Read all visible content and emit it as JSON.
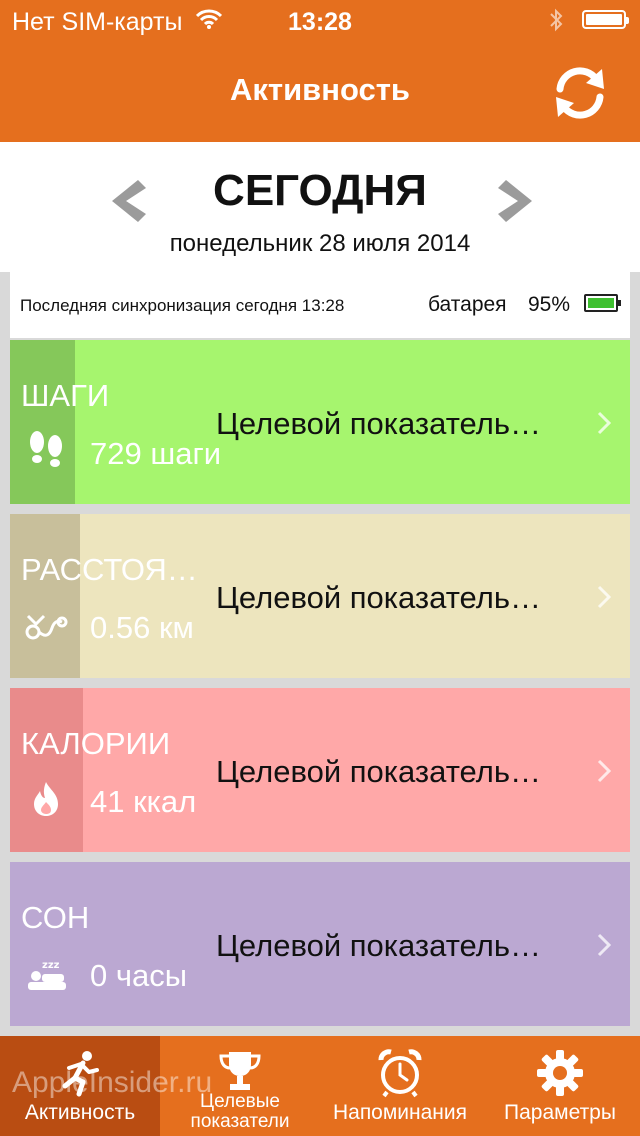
{
  "status_bar": {
    "carrier": "Нет SIM-карты",
    "time": "13:28",
    "wifi_icon": "wifi-icon",
    "bluetooth_icon": "bluetooth-icon",
    "battery_icon": "battery-icon"
  },
  "navbar": {
    "title": "Активность",
    "sync_icon": "sync-icon"
  },
  "date_header": {
    "day": "СЕГОДНЯ",
    "date": "понедельник 28 июля 2014"
  },
  "sync_info": {
    "last_sync": "Последняя синхронизация сегодня 13:28",
    "battery_label": "батарея",
    "battery_percent": "95%"
  },
  "cards": [
    {
      "label": "ШАГИ",
      "value": "729 шаги",
      "goal": "Целевой показатель…",
      "icon": "footsteps-icon",
      "color": "#a6f56e",
      "strip_color": "#85c85a"
    },
    {
      "label": "РАССТОЯ…",
      "value": "0.56 км",
      "goal": "Целевой показатель…",
      "icon": "route-icon",
      "color": "#ede5be",
      "strip_color": "#c8bf9b"
    },
    {
      "label": "КАЛОРИИ",
      "value": "41 ккал",
      "goal": "Целевой показатель…",
      "icon": "flame-icon",
      "color": "#ffa8a8",
      "strip_color": "#e98b8b"
    },
    {
      "label": "СОН",
      "value": "0 часы",
      "goal": "Целевой показатель…",
      "icon": "sleep-icon",
      "color": "#bba8d2",
      "strip_color": "#bba8d2"
    }
  ],
  "tabs": [
    {
      "label": "Активность",
      "icon": "running-icon",
      "active": true
    },
    {
      "label": "Целевые показатели",
      "icon": "trophy-icon",
      "active": false
    },
    {
      "label": "Напоминания",
      "icon": "alarm-clock-icon",
      "active": false
    },
    {
      "label": "Параметры",
      "icon": "gear-icon",
      "active": false
    }
  ],
  "watermark": "AppleInsider.ru"
}
